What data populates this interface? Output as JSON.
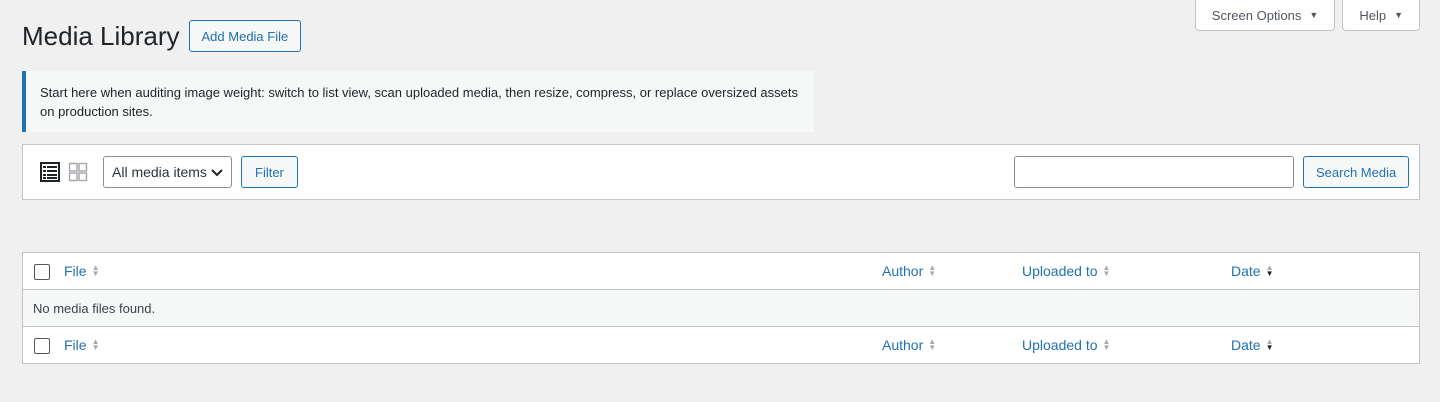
{
  "screen_meta": {
    "screen_options_label": "Screen Options",
    "help_label": "Help"
  },
  "header": {
    "title": "Media Library",
    "add_button_label": "Add Media File"
  },
  "notice": {
    "text": "Start here when auditing image weight: switch to list view, scan uploaded media, then resize, compress, or replace oversized assets on production sites."
  },
  "toolbar": {
    "filter_select_value": "All media items",
    "filter_button_label": "Filter",
    "search_value": "",
    "search_button_label": "Search Media",
    "active_view": "list"
  },
  "table": {
    "columns": [
      "File",
      "Author",
      "Uploaded to",
      "Date"
    ],
    "sorted_column": "Date",
    "sort_direction": "desc",
    "empty_message": "No media files found."
  },
  "colors": {
    "accent": "#2271b1",
    "background": "#f0f0f1",
    "border": "#c3c4c7"
  }
}
